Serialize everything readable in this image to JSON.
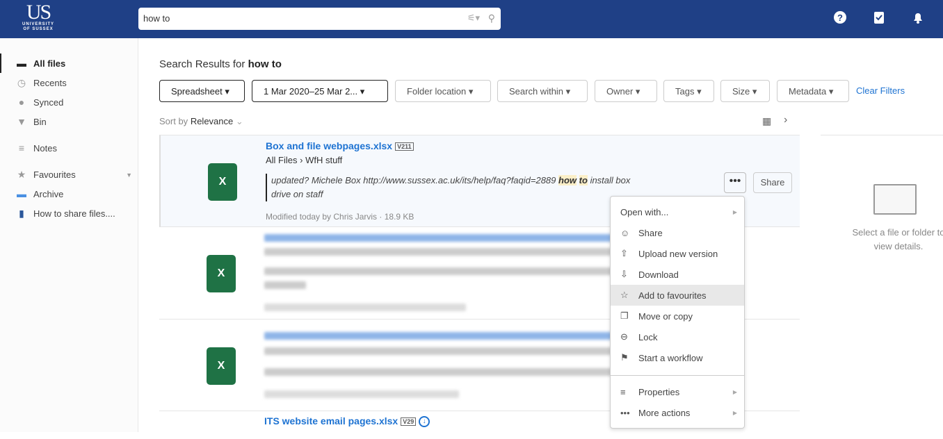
{
  "header": {
    "logo_main": "US",
    "logo_sub": "UNIVERSITY OF SUSSEX",
    "search_value": "how to",
    "icons": [
      "filter-icon",
      "search-icon",
      "help-icon",
      "tasks-icon",
      "bell-icon"
    ]
  },
  "sidebar": {
    "items": [
      {
        "label": "All files",
        "icon": "folder-icon"
      },
      {
        "label": "Recents",
        "icon": "clock-icon"
      },
      {
        "label": "Synced",
        "icon": "sync-icon"
      },
      {
        "label": "Bin",
        "icon": "bin-icon"
      },
      {
        "label": "Notes",
        "icon": "notes-icon"
      },
      {
        "label": "Favourites",
        "icon": "star-icon"
      },
      {
        "label": "Archive",
        "icon": "folder-icon"
      },
      {
        "label": "How to share files....",
        "icon": "word-icon"
      }
    ]
  },
  "main": {
    "title_prefix": "Search Results for",
    "query": "how to",
    "filters": [
      "Spreadsheet",
      "1 Mar 2020–25 Mar 2...",
      "Folder location",
      "Search within",
      "Owner",
      "Tags",
      "Size",
      "Metadata"
    ],
    "clear_filters": "Clear Filters",
    "sort_label": "Sort by",
    "sort_value": "Relevance",
    "result1": {
      "name": "Box and file webpages.xlsx",
      "version": "V211",
      "path_root": "All Files",
      "path_folder": "WfH stuff",
      "snippet_before": "updated? Michele Box http://www.sussex.ac.uk/its/help/faq?faqid=2889",
      "hl1": "how",
      "hl2": "to",
      "snippet_after": "install box drive on staff",
      "meta": "Modified today by Chris Jarvis · 18.9 KB",
      "more": "•••",
      "share": "Share"
    },
    "result4": {
      "name": "ITS website email pages.xlsx",
      "version": "V29"
    }
  },
  "menu": {
    "items": [
      {
        "label": "Open with...",
        "icon": "",
        "submenu": true
      },
      {
        "label": "Share",
        "icon": "share-icon"
      },
      {
        "label": "Upload new version",
        "icon": "upload-icon"
      },
      {
        "label": "Download",
        "icon": "download-icon"
      },
      {
        "label": "Add to favourites",
        "icon": "star-icon",
        "hover": true
      },
      {
        "label": "Move or copy",
        "icon": "copy-icon"
      },
      {
        "label": "Lock",
        "icon": "lock-icon"
      },
      {
        "label": "Start a workflow",
        "icon": "flag-icon"
      },
      {
        "label": "Properties",
        "icon": "properties-icon",
        "submenu": true
      },
      {
        "label": "More actions",
        "icon": "more-icon",
        "submenu": true
      }
    ]
  },
  "details": {
    "empty_text": "Select a file or folder to view details."
  }
}
